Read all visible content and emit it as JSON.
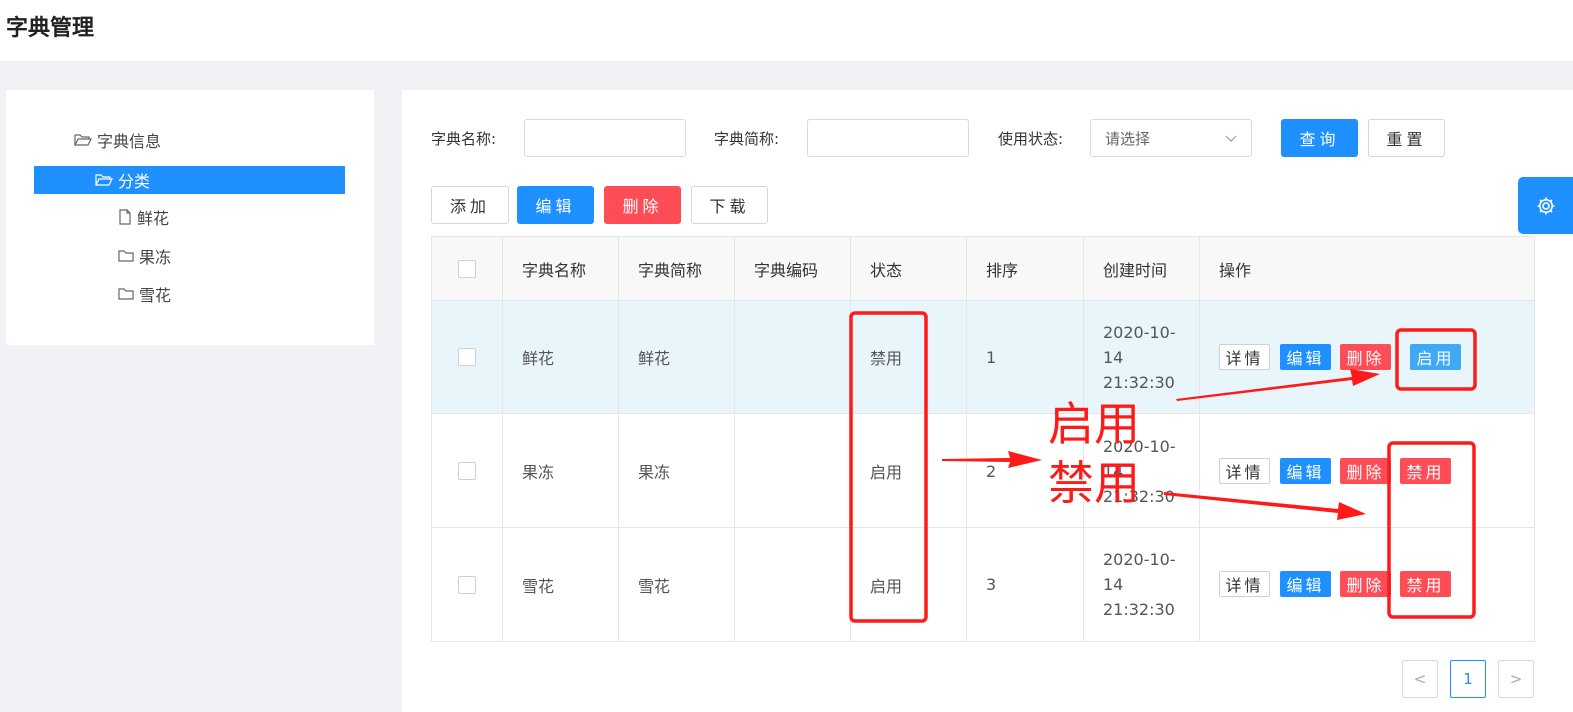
{
  "page": {
    "title": "字典管理"
  },
  "tree": {
    "root": "字典信息",
    "selected": "分类",
    "children": [
      "鲜花",
      "果冻",
      "雪花"
    ]
  },
  "search": {
    "name_label": "字典名称:",
    "abbr_label": "字典简称:",
    "status_label": "使用状态:",
    "status_placeholder": "请选择",
    "query_btn": "查询",
    "reset_btn": "重置"
  },
  "toolbar": {
    "add": "添加",
    "edit": "编辑",
    "delete": "删除",
    "download": "下载"
  },
  "table": {
    "headers": [
      "字典名称",
      "字典简称",
      "字典编码",
      "状态",
      "排序",
      "创建时间",
      "操作"
    ],
    "rows": [
      {
        "name": "鲜花",
        "abbr": "鲜花",
        "code": "",
        "status": "禁用",
        "order": "1",
        "time": [
          "2020-10-",
          "14",
          "21:32:30"
        ],
        "ops": [
          "详情",
          "编辑",
          "删除",
          "启用"
        ]
      },
      {
        "name": "果冻",
        "abbr": "果冻",
        "code": "",
        "status": "启用",
        "order": "2",
        "time": [
          "2020-10-",
          "14",
          "21:32:30"
        ],
        "ops": [
          "详情",
          "编辑",
          "删除",
          "禁用"
        ]
      },
      {
        "name": "雪花",
        "abbr": "雪花",
        "code": "",
        "status": "启用",
        "order": "3",
        "time": [
          "2020-10-",
          "14",
          "21:32:30"
        ],
        "ops": [
          "详情",
          "编辑",
          "删除",
          "禁用"
        ]
      }
    ]
  },
  "pagination": {
    "prev": "<",
    "current": "1",
    "next": ">"
  },
  "annotations": {
    "enable_text": "启用",
    "disable_text": "禁用",
    "color": "#ff1a1a"
  },
  "colors": {
    "primary": "#1e90ff",
    "danger": "#ff4d57",
    "highlight_row": "#e8f5fb"
  }
}
